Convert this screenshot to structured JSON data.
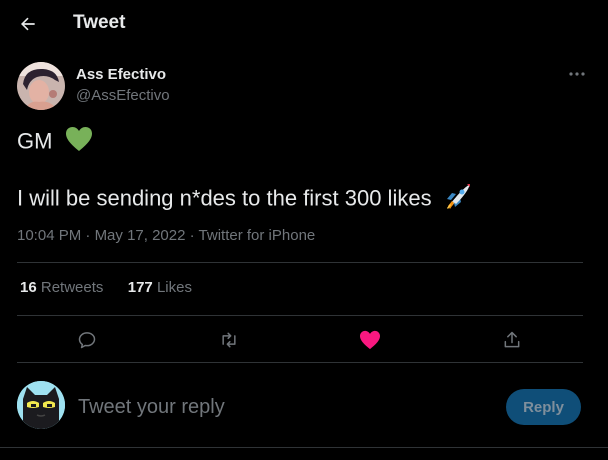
{
  "header": {
    "title": "Tweet",
    "back_icon": "arrow-left-icon"
  },
  "author": {
    "name": "Ass Efectivo",
    "handle": "@AssEfectivo",
    "more_icon": "more-horizontal-icon"
  },
  "tweet": {
    "line1": "GM",
    "line1_emoji": "green-heart-emoji",
    "line2": "I will be sending n*des to the first 300 likes",
    "line2_emoji": "rocket-emoji",
    "time": "10:04 PM",
    "separator1": " · ",
    "date": "May 17, 2022",
    "separator2": " · ",
    "source": "Twitter for iPhone"
  },
  "stats": {
    "retweets_count": "16",
    "retweets_label": "Retweets",
    "likes_count": "177",
    "likes_label": "Likes"
  },
  "actions": {
    "reply_icon": "reply-icon",
    "retweet_icon": "retweet-icon",
    "like_icon": "heart-icon",
    "share_icon": "share-icon",
    "like_color": "#f91880"
  },
  "reply": {
    "placeholder": "Tweet your reply",
    "button_label": "Reply"
  },
  "colors": {
    "background": "#000000",
    "text": "#e7e9ea",
    "muted": "#71767b",
    "reply_button_bg": "#0f4e78"
  }
}
